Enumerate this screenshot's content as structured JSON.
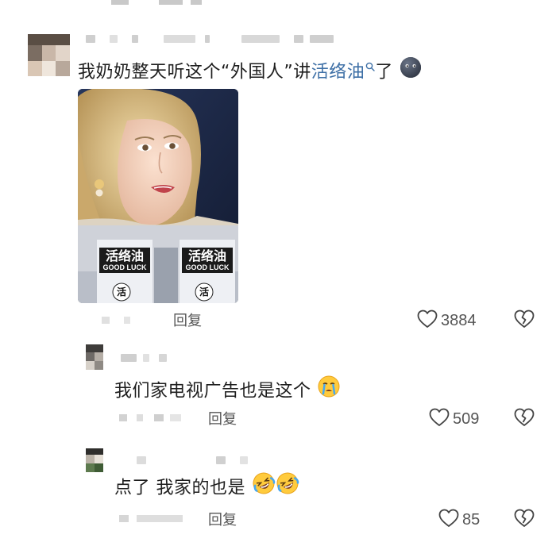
{
  "comments": [
    {
      "text_before": "我奶奶整天听这个“外国人”讲",
      "link_text": "活络油",
      "text_after": "了",
      "reply_label": "回复",
      "likes": "3884",
      "meme": {
        "box_labels": [
          "活络油",
          "活络油"
        ],
        "box_sublabels": [
          "GOOD LUCK",
          "GOOD LUCK"
        ],
        "box_small_char": [
          "活",
          "活"
        ]
      }
    },
    {
      "text": "我们家电视广告也是这个",
      "reply_label": "回复",
      "likes": "509"
    },
    {
      "text": "点了 我家的也是",
      "reply_label": "回复",
      "likes": "85"
    }
  ],
  "icons": {
    "like": "heart-outline-icon",
    "dislike": "broken-heart-icon",
    "search": "search-icon"
  }
}
